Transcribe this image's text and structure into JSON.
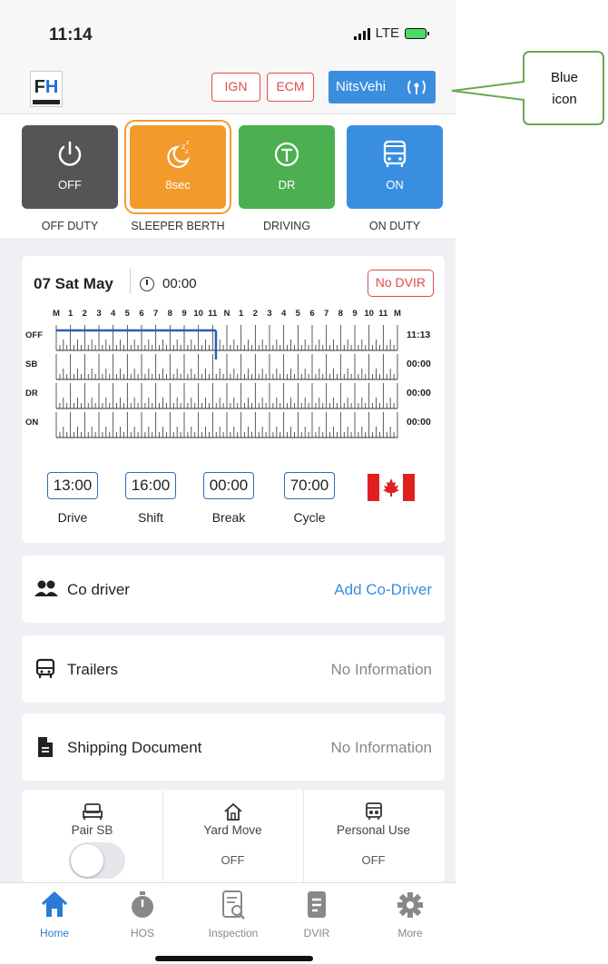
{
  "status_bar": {
    "time": "11:14",
    "network": "LTE"
  },
  "header": {
    "logo_f": "F",
    "logo_h": "H",
    "ign_label": "IGN",
    "ecm_label": "ECM",
    "vehicle_label": "NitsVehi",
    "vehicle_icon": "antenna-signal-icon"
  },
  "duty_status": [
    {
      "tile_label": "OFF",
      "caption": "OFF DUTY",
      "color": "#555555",
      "icon": "power-icon"
    },
    {
      "tile_label": "8sec",
      "caption": "SLEEPER BERTH",
      "color": "#f39a2d",
      "icon": "moon-zzz-icon"
    },
    {
      "tile_label": "DR",
      "caption": "DRIVING",
      "color": "#4caf50",
      "icon": "steering-icon"
    },
    {
      "tile_label": "ON",
      "caption": "ON DUTY",
      "color": "#3a8ee0",
      "icon": "truck-icon"
    }
  ],
  "log": {
    "date": "07 Sat May",
    "time": "00:00",
    "dvir_badge": "No DVIR",
    "hour_labels": [
      "M",
      "1",
      "2",
      "3",
      "4",
      "5",
      "6",
      "7",
      "8",
      "9",
      "10",
      "11",
      "N",
      "1",
      "2",
      "3",
      "4",
      "5",
      "6",
      "7",
      "8",
      "9",
      "10",
      "11",
      "M"
    ],
    "rows": [
      {
        "label": "OFF",
        "total": "11:13"
      },
      {
        "label": "SB",
        "total": "00:00"
      },
      {
        "label": "DR",
        "total": "00:00"
      },
      {
        "label": "ON",
        "total": "00:00"
      }
    ],
    "graph_segments": [
      {
        "status": "OFF",
        "start_hour": 0,
        "end_hour": 11.23
      },
      {
        "status": "SB",
        "start_hour": 11.23,
        "end_hour": 11.23
      }
    ],
    "line_color": "#2a5fb0",
    "clocks": [
      {
        "value": "13:00",
        "caption": "Drive"
      },
      {
        "value": "16:00",
        "caption": "Shift"
      },
      {
        "value": "00:00",
        "caption": "Break"
      },
      {
        "value": "70:00",
        "caption": "Cycle"
      }
    ],
    "region_flag": "canada-flag-icon"
  },
  "rows": [
    {
      "label": "Co driver",
      "value": "Add Co-Driver",
      "icon": "people-icon",
      "is_link": true
    },
    {
      "label": "Trailers",
      "value": "No Information",
      "icon": "trailer-icon",
      "is_link": false
    },
    {
      "label": "Shipping Document",
      "value": "No Information",
      "icon": "document-icon",
      "is_link": false
    }
  ],
  "quick_toggles": [
    {
      "label": "Pair SB",
      "status": "",
      "icon": "bed-icon",
      "enabled": false
    },
    {
      "label": "Yard Move",
      "status": "OFF",
      "icon": "house-icon"
    },
    {
      "label": "Personal Use",
      "status": "OFF",
      "icon": "car-person-icon"
    }
  ],
  "tabs": [
    {
      "label": "Home",
      "icon": "home-icon",
      "active": true
    },
    {
      "label": "HOS",
      "icon": "stopwatch-icon",
      "active": false
    },
    {
      "label": "Inspection",
      "icon": "inspection-icon",
      "active": false
    },
    {
      "label": "DVIR",
      "icon": "clipboard-icon",
      "active": false
    },
    {
      "label": "More",
      "icon": "gear-icon",
      "active": false
    }
  ],
  "callout": {
    "line1": "Blue",
    "line2": "icon",
    "border_color": "#6aa84f"
  }
}
